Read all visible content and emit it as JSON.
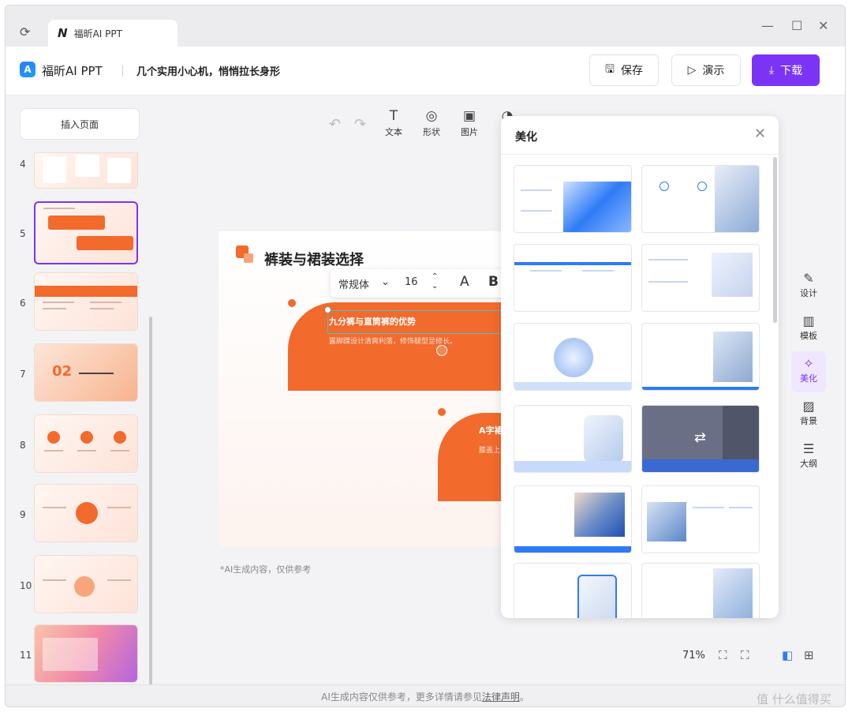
{
  "tab": {
    "title": "福昕AI PPT"
  },
  "header": {
    "app_name": "福昕AI PPT",
    "doc_title": "几个实用小心机，悄悄拉长身形",
    "save_label": "保存",
    "present_label": "演示",
    "download_label": "下载"
  },
  "sidebar": {
    "insert_label": "插入页面",
    "slide_numbers": [
      "4",
      "5",
      "6",
      "7",
      "8",
      "9",
      "10",
      "11"
    ]
  },
  "toolbar": {
    "items": [
      "文本",
      "形状",
      "图片"
    ]
  },
  "format_bar": {
    "font": "常规体",
    "size": "16",
    "color_glyph": "A",
    "bold_glyph": "B"
  },
  "slide": {
    "title": "裤装与裙装选择",
    "card1_heading": "九分裤与直筒裤的优势",
    "card1_body": "露脚踝设计清爽利落，修饰腿型显修长。",
    "card2_heading": "A字裙",
    "card2_body": "膝盖上"
  },
  "canvas": {
    "ai_note": "*AI生成内容，仅供参考"
  },
  "rail": {
    "design": "设计",
    "template": "模板",
    "beautify": "美化",
    "background": "背景",
    "outline": "大纲"
  },
  "panel": {
    "title": "美化"
  },
  "footer": {
    "zoom": "71%",
    "status_prefix": "AI生成内容仅供参考，更多详情请参见",
    "status_link": "法律声明",
    "status_suffix": "。",
    "watermark": "值 什么值得买"
  },
  "colors": {
    "accent": "#7b34f6",
    "slide_orange": "#f26a2c",
    "template_blue": "#2f7bf6"
  }
}
